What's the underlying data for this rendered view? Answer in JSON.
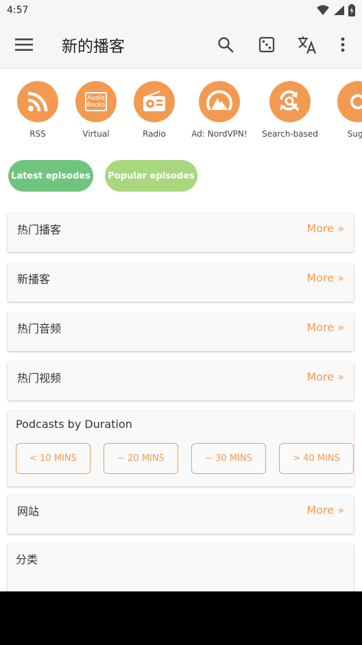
{
  "status": {
    "time": "4:57"
  },
  "app_bar": {
    "title": "新的播客"
  },
  "categories": [
    {
      "label": "RSS",
      "icon": "rss-icon"
    },
    {
      "label": "Virtual",
      "icon": "audiobook-icon",
      "badge_line1": "Audio",
      "badge_line2": "Books"
    },
    {
      "label": "Radio",
      "icon": "radio-icon"
    },
    {
      "label": "Ad: NordVPN!",
      "icon": "nordvpn-icon"
    },
    {
      "label": "Search-based",
      "icon": "search-refresh-icon"
    },
    {
      "label": "Sugg",
      "icon": "suggest-icon"
    }
  ],
  "pills": {
    "latest": "Latest episodes",
    "popular": "Popular episodes"
  },
  "sections": [
    {
      "title": "热门播客",
      "more": "More »"
    },
    {
      "title": "新播客",
      "more": "More »"
    },
    {
      "title": "热门音频",
      "more": "More »"
    },
    {
      "title": "热门视频",
      "more": "More »"
    }
  ],
  "duration": {
    "title": "Podcasts by Duration",
    "buttons": [
      "< 10 MINS",
      "~ 20 MINS",
      "~ 30 MINS",
      "> 40 MINS"
    ]
  },
  "websites": {
    "title": "网站",
    "more": "More »"
  },
  "categories_section": {
    "title": "分类"
  },
  "colors": {
    "accent": "#f39a52",
    "green": "#6fc47f",
    "light_green": "#a8d77e"
  }
}
